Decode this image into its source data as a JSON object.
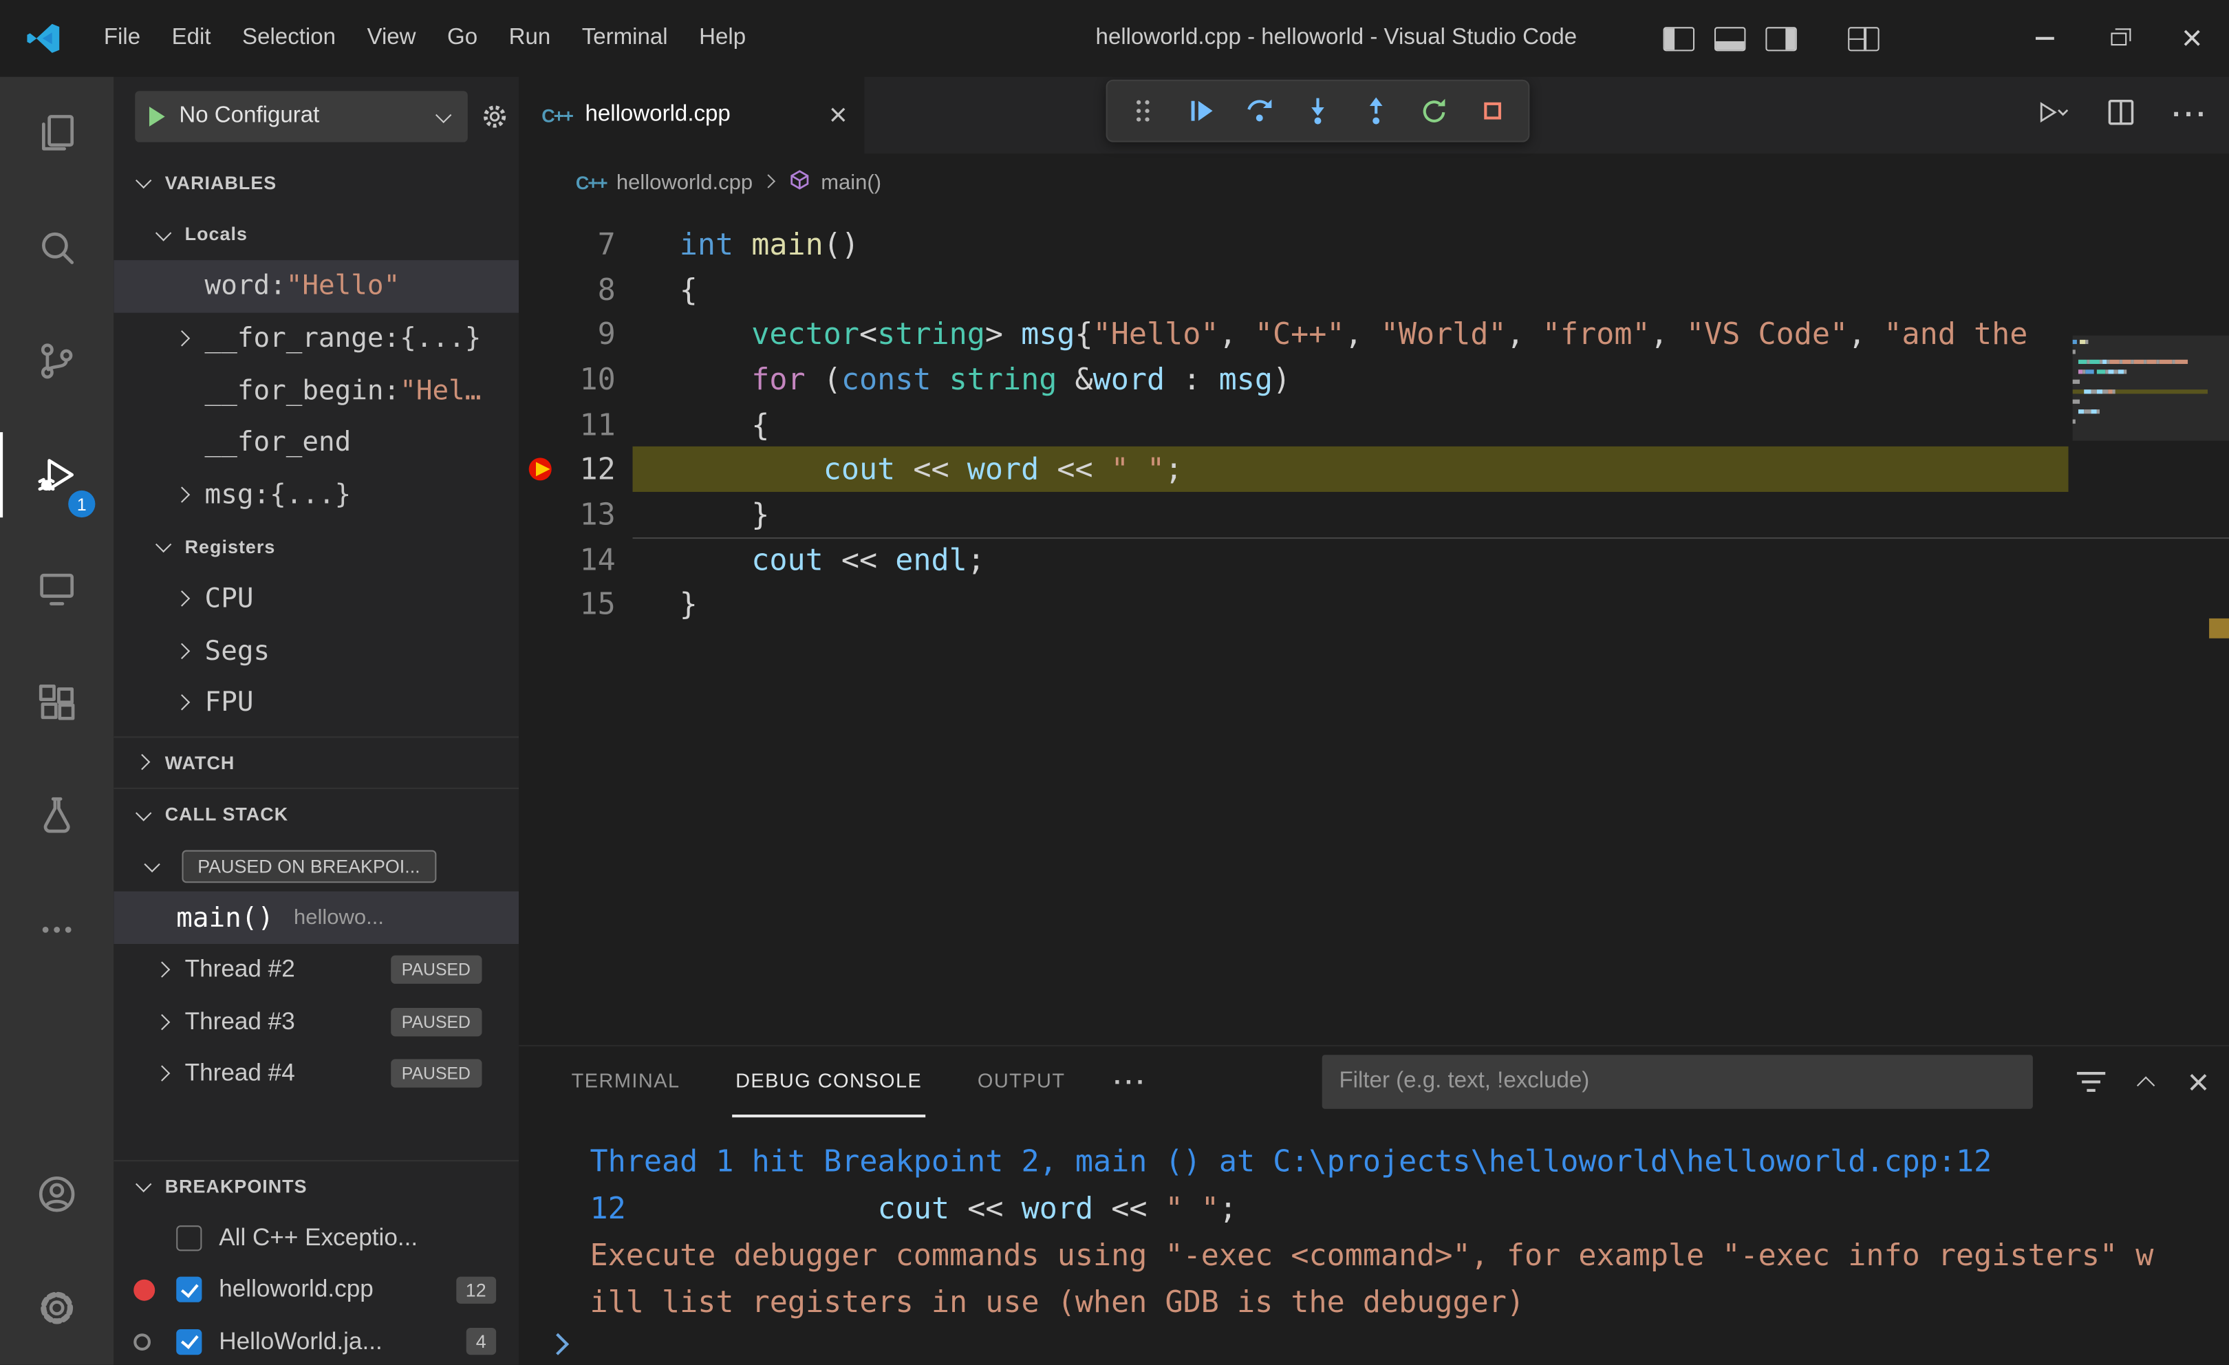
{
  "window": {
    "title": "helloworld.cpp - helloworld - Visual Studio Code",
    "menus": [
      "File",
      "Edit",
      "Selection",
      "View",
      "Go",
      "Run",
      "Terminal",
      "Help"
    ]
  },
  "activity_bar": {
    "debug_badge": "1"
  },
  "sidebar": {
    "config_label": "No Configurat",
    "variables": {
      "header": "VARIABLES",
      "locals_label": "Locals",
      "locals": [
        {
          "name": "word: ",
          "value": "\"Hello\""
        },
        {
          "name": "__for_range: ",
          "value": "{...}"
        },
        {
          "name": "__for_begin: ",
          "value": "\"Hel…"
        },
        {
          "name": "__for_end",
          "value": ""
        },
        {
          "name": "msg: ",
          "value": "{...}"
        }
      ],
      "registers_label": "Registers",
      "registers": [
        {
          "name": "CPU"
        },
        {
          "name": "Segs"
        },
        {
          "name": "FPU"
        }
      ]
    },
    "watch": {
      "header": "WATCH"
    },
    "call_stack": {
      "header": "CALL STACK",
      "status": "PAUSED ON BREAKPOI...",
      "frame_name": "main()",
      "frame_detail": "hellowo...",
      "threads": [
        {
          "label": "Thread #2",
          "badge": "PAUSED"
        },
        {
          "label": "Thread #3",
          "badge": "PAUSED"
        },
        {
          "label": "Thread #4",
          "badge": "PAUSED"
        }
      ]
    },
    "breakpoints": {
      "header": "BREAKPOINTS",
      "items": [
        {
          "label": "All C++ Exceptio...",
          "count": ""
        },
        {
          "label": "helloworld.cpp",
          "count": "12"
        },
        {
          "label": "HelloWorld.ja...",
          "count": "4"
        }
      ]
    }
  },
  "editor": {
    "tab_label": "helloworld.cpp",
    "cpp_icon_text": "C++",
    "breadcrumb_file": "helloworld.cpp",
    "breadcrumb_symbol": "main()",
    "code_lines": [
      {
        "num": "7",
        "tokens": [
          [
            "int",
            "kw"
          ],
          [
            " ",
            "pl"
          ],
          [
            "main",
            "fn"
          ],
          [
            "()",
            "pl"
          ]
        ]
      },
      {
        "num": "8",
        "tokens": [
          [
            "{",
            "pl"
          ]
        ]
      },
      {
        "num": "9",
        "tokens": [
          [
            "    ",
            "pl"
          ],
          [
            "vector",
            "ty"
          ],
          [
            "<",
            "pl"
          ],
          [
            "string",
            "ty"
          ],
          [
            "> ",
            "pl"
          ],
          [
            "msg",
            "vr"
          ],
          [
            "{",
            "pl"
          ],
          [
            "\"Hello\"",
            "st"
          ],
          [
            ", ",
            "pl"
          ],
          [
            "\"C++\"",
            "st"
          ],
          [
            ", ",
            "pl"
          ],
          [
            "\"World\"",
            "st"
          ],
          [
            ", ",
            "pl"
          ],
          [
            "\"from\"",
            "st"
          ],
          [
            ", ",
            "pl"
          ],
          [
            "\"VS Code\"",
            "st"
          ],
          [
            ", ",
            "pl"
          ],
          [
            "\"and the",
            "st"
          ]
        ]
      },
      {
        "num": "10",
        "tokens": [
          [
            "    ",
            "pl"
          ],
          [
            "for",
            "ct"
          ],
          [
            " (",
            "pl"
          ],
          [
            "const",
            "kw"
          ],
          [
            " ",
            "pl"
          ],
          [
            "string",
            "ty"
          ],
          [
            " &",
            "pl"
          ],
          [
            "word",
            "vr"
          ],
          [
            " : ",
            "pl"
          ],
          [
            "msg",
            "vr"
          ],
          [
            ")",
            "pl"
          ]
        ]
      },
      {
        "num": "11",
        "tokens": [
          [
            "    {",
            "pl"
          ]
        ]
      },
      {
        "num": "12",
        "current": true,
        "tokens": [
          [
            "        ",
            "pl"
          ],
          [
            "cout",
            "vr"
          ],
          [
            " << ",
            "pl"
          ],
          [
            "word",
            "vr"
          ],
          [
            " << ",
            "pl"
          ],
          [
            "\" \"",
            "st"
          ],
          [
            ";",
            "pl"
          ]
        ]
      },
      {
        "num": "13",
        "underline": true,
        "tokens": [
          [
            "    }",
            "pl"
          ]
        ]
      },
      {
        "num": "14",
        "tokens": [
          [
            "    ",
            "pl"
          ],
          [
            "cout",
            "vr"
          ],
          [
            " << ",
            "pl"
          ],
          [
            "endl",
            "vr"
          ],
          [
            ";",
            "pl"
          ]
        ]
      },
      {
        "num": "15",
        "tokens": [
          [
            "}",
            "pl"
          ]
        ]
      }
    ]
  },
  "panel": {
    "tabs": {
      "terminal": "TERMINAL",
      "debug_console": "DEBUG CONSOLE",
      "output": "OUTPUT"
    },
    "more_label": "···",
    "filter_placeholder": "Filter (e.g. text, !exclude)",
    "console_lines": [
      {
        "tokens": [
          [
            "Thread 1 hit Breakpoint 2, main () at C:\\projects\\helloworld\\helloworld.cpp:12",
            "bl"
          ]
        ]
      },
      {
        "tokens": [
          [
            "12",
            "bl"
          ],
          [
            "              ",
            "pl"
          ],
          [
            "cout",
            "vr"
          ],
          [
            " << ",
            "pl"
          ],
          [
            "word",
            "vr"
          ],
          [
            " << ",
            "pl"
          ],
          [
            "\" \"",
            "st"
          ],
          [
            ";",
            "pl"
          ]
        ]
      },
      {
        "tokens": [
          [
            "Execute debugger commands using \"-exec <command>\", for example \"-exec info registers\" w",
            "or"
          ]
        ]
      },
      {
        "tokens": [
          [
            "ill list registers in use (when GDB is the debugger)",
            "or"
          ]
        ]
      }
    ]
  }
}
